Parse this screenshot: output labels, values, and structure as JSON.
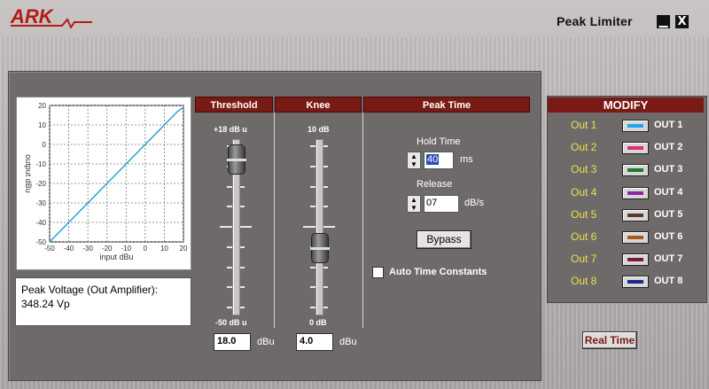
{
  "app": {
    "logo_text": "ARK",
    "title": "Peak Limiter"
  },
  "window_controls": {
    "minimize": "▁",
    "close": "X"
  },
  "graph": {
    "y_label": "output dBu",
    "x_label": "input dBu",
    "y_ticks": [
      "20",
      "10",
      "0",
      "-10",
      "-20",
      "-30",
      "-40",
      "-50"
    ],
    "x_ticks": [
      "-50",
      "-40",
      "-30",
      "-20",
      "-10",
      "0",
      "10",
      "20"
    ],
    "curve": {
      "color": "#1a9fd6",
      "points": [
        [
          -50,
          -50
        ],
        [
          17,
          17
        ],
        [
          20,
          19
        ]
      ]
    }
  },
  "info": {
    "line1": "Peak Voltage (Out Amplifier):",
    "line2": "348.24 Vp"
  },
  "threshold": {
    "header": "Threshold",
    "max_label": "+18 dB u",
    "min_label": "-50 dB u",
    "value": "18.0",
    "unit": "dBu",
    "level": 1.0
  },
  "knee": {
    "header": "Knee",
    "max_label": "10 dB",
    "min_label": "0 dB",
    "value": "4.0",
    "unit": "dBu",
    "level": 0.4
  },
  "peak_time": {
    "header": "Peak Time",
    "hold_label": "Hold Time",
    "hold_value": "40",
    "hold_unit": "ms",
    "release_label": "Release",
    "release_value": "07",
    "release_unit": "dB/s",
    "bypass_label": "Bypass",
    "auto_label": "Auto Time Constants",
    "auto_checked": false
  },
  "modify": {
    "header": "MODIFY",
    "outputs": [
      {
        "label": "Out 1",
        "name": "OUT 1",
        "color": "#1aa8e8"
      },
      {
        "label": "Out 2",
        "name": "OUT 2",
        "color": "#e02a7a"
      },
      {
        "label": "Out 3",
        "name": "OUT 3",
        "color": "#1f7a2a"
      },
      {
        "label": "Out 4",
        "name": "OUT 4",
        "color": "#8a2aa0"
      },
      {
        "label": "Out 5",
        "name": "OUT 5",
        "color": "#5a3a2a"
      },
      {
        "label": "Out 6",
        "name": "OUT 6",
        "color": "#a85a1a"
      },
      {
        "label": "Out 7",
        "name": "OUT 7",
        "color": "#7a1a3a"
      },
      {
        "label": "Out 8",
        "name": "OUT 8",
        "color": "#1a2a8a"
      }
    ]
  },
  "realtime": {
    "label": "Real Time"
  }
}
